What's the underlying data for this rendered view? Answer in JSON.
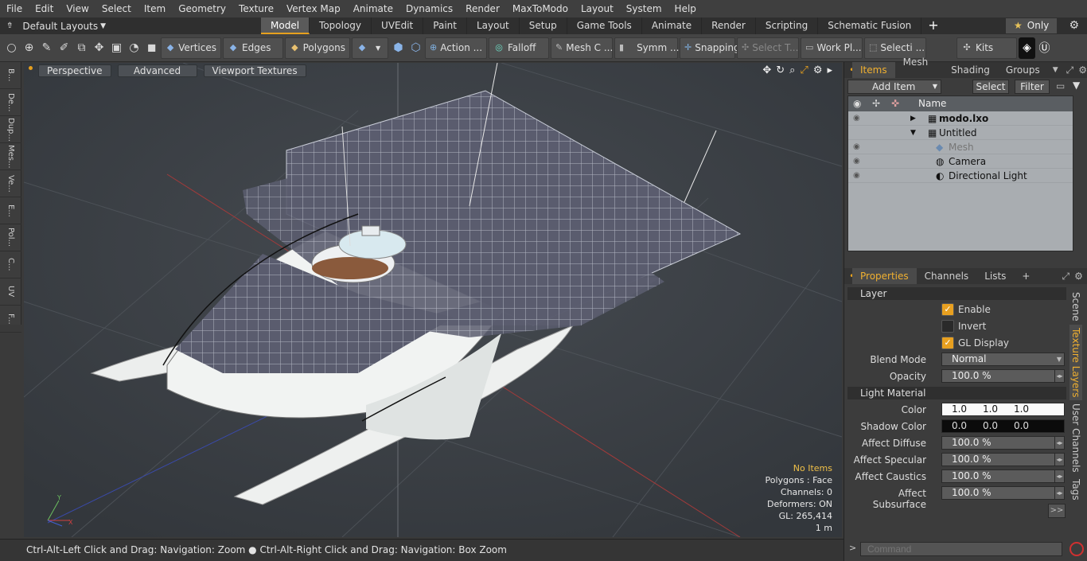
{
  "menu": [
    "File",
    "Edit",
    "View",
    "Select",
    "Item",
    "Geometry",
    "Texture",
    "Vertex Map",
    "Animate",
    "Dynamics",
    "Render",
    "MaxToModo",
    "Layout",
    "System",
    "Help"
  ],
  "layouts": {
    "label": "Default Layouts"
  },
  "tabs": [
    "Model",
    "Topology",
    "UVEdit",
    "Paint",
    "Layout",
    "Setup",
    "Game Tools",
    "Animate",
    "Render",
    "Scripting",
    "Schematic Fusion"
  ],
  "active_tab": "Model",
  "only_label": "Only",
  "toolbar": {
    "vertices": "Vertices",
    "edges": "Edges",
    "polygons": "Polygons",
    "action": "Action ...",
    "falloff": "Falloff",
    "mesh": "Mesh C ...",
    "symm": "Symm ...",
    "snapping": "Snapping",
    "select_t": "Select T...",
    "work_pl": "Work Pl...",
    "selecti": "Selecti ...",
    "kits": "Kits"
  },
  "left_tabs": [
    "B...",
    "De...",
    "Dup...",
    "Mes...",
    "Ve...",
    "E...",
    "Pol...",
    "C...",
    "UV",
    "F..."
  ],
  "viewport": {
    "view": "Perspective",
    "advanced": "Advanced",
    "textures": "Viewport Textures",
    "hud": {
      "items": "No Items",
      "polygons": "Polygons : Face",
      "channels": "Channels: 0",
      "deformers": "Deformers: ON",
      "gl": "GL: 265,414",
      "scale": "1 m"
    }
  },
  "status": "Ctrl-Alt-Left Click and Drag: Navigation: Zoom ● Ctrl-Alt-Right Click and Drag: Navigation: Box Zoom",
  "items_panel": {
    "tabs": [
      "Items",
      "Mesh ...",
      "Shading",
      "Groups"
    ],
    "add_item": "Add Item",
    "select": "Select",
    "filter": "Filter",
    "name_header": "Name",
    "rows": [
      {
        "name": "modo.lxo"
      },
      {
        "name": "Untitled"
      },
      {
        "name": "Mesh"
      },
      {
        "name": "Camera"
      },
      {
        "name": "Directional Light"
      }
    ]
  },
  "properties": {
    "tabs": [
      "Properties",
      "Channels",
      "Lists"
    ],
    "layer_section": "Layer",
    "enable": "Enable",
    "invert": "Invert",
    "gl_display": "GL Display",
    "blend_mode_label": "Blend Mode",
    "blend_mode": "Normal",
    "opacity_label": "Opacity",
    "opacity": "100.0 %",
    "light_section": "Light Material",
    "color_label": "Color",
    "color": [
      "1.0",
      "1.0",
      "1.0"
    ],
    "shadow_label": "Shadow Color",
    "shadow": [
      "0.0",
      "0.0",
      "0.0"
    ],
    "affect_diffuse_label": "Affect Diffuse",
    "affect_diffuse": "100.0 %",
    "affect_specular_label": "Affect Specular",
    "affect_specular": "100.0 %",
    "affect_caustics_label": "Affect Caustics",
    "affect_caustics": "100.0 %",
    "affect_subsurface_label": "Affect Subsurface",
    "affect_subsurface": "100.0 %",
    "side_tabs": [
      "Scene",
      "Texture Layers",
      "User Channels",
      "Tags"
    ]
  },
  "command_placeholder": "Command"
}
